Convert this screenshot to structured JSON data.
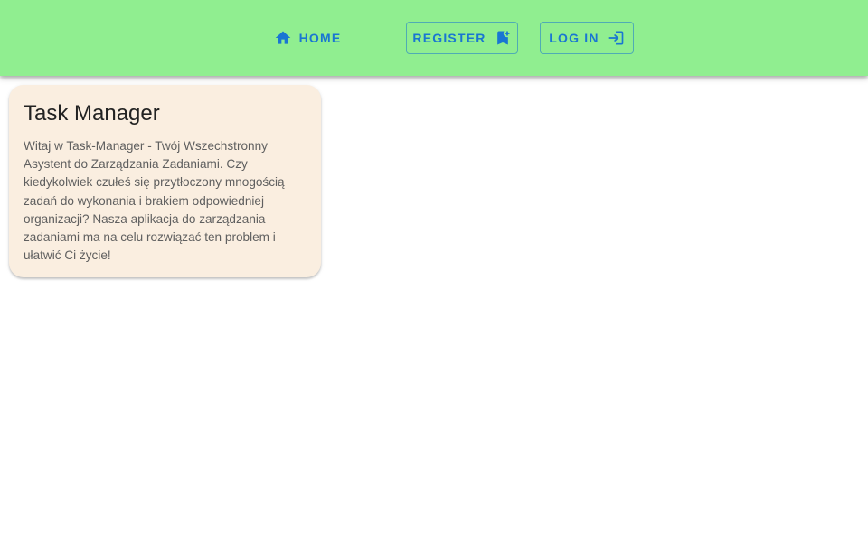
{
  "nav": {
    "home_label": "Home",
    "register_label": "Register",
    "login_label": "Log in",
    "home_icon": "home-icon",
    "register_icon": "bookmark-add-icon",
    "login_icon": "login-icon",
    "accent_color": "#1976d2",
    "bar_color": "#90ee90"
  },
  "card": {
    "title": "Task Manager",
    "body": "Witaj w Task-Manager - Twój Wszechstronny Asystent do Zarządzania Zadaniami. Czy kiedykolwiek czułeś się przytłoczony mnogością zadań do wykonania i brakiem odpowiedniej organizacji? Nasza aplikacja do zarządzania zadaniami ma na celu rozwiązać ten problem i ułatwić Ci życie!",
    "background_color": "#faeee0"
  }
}
